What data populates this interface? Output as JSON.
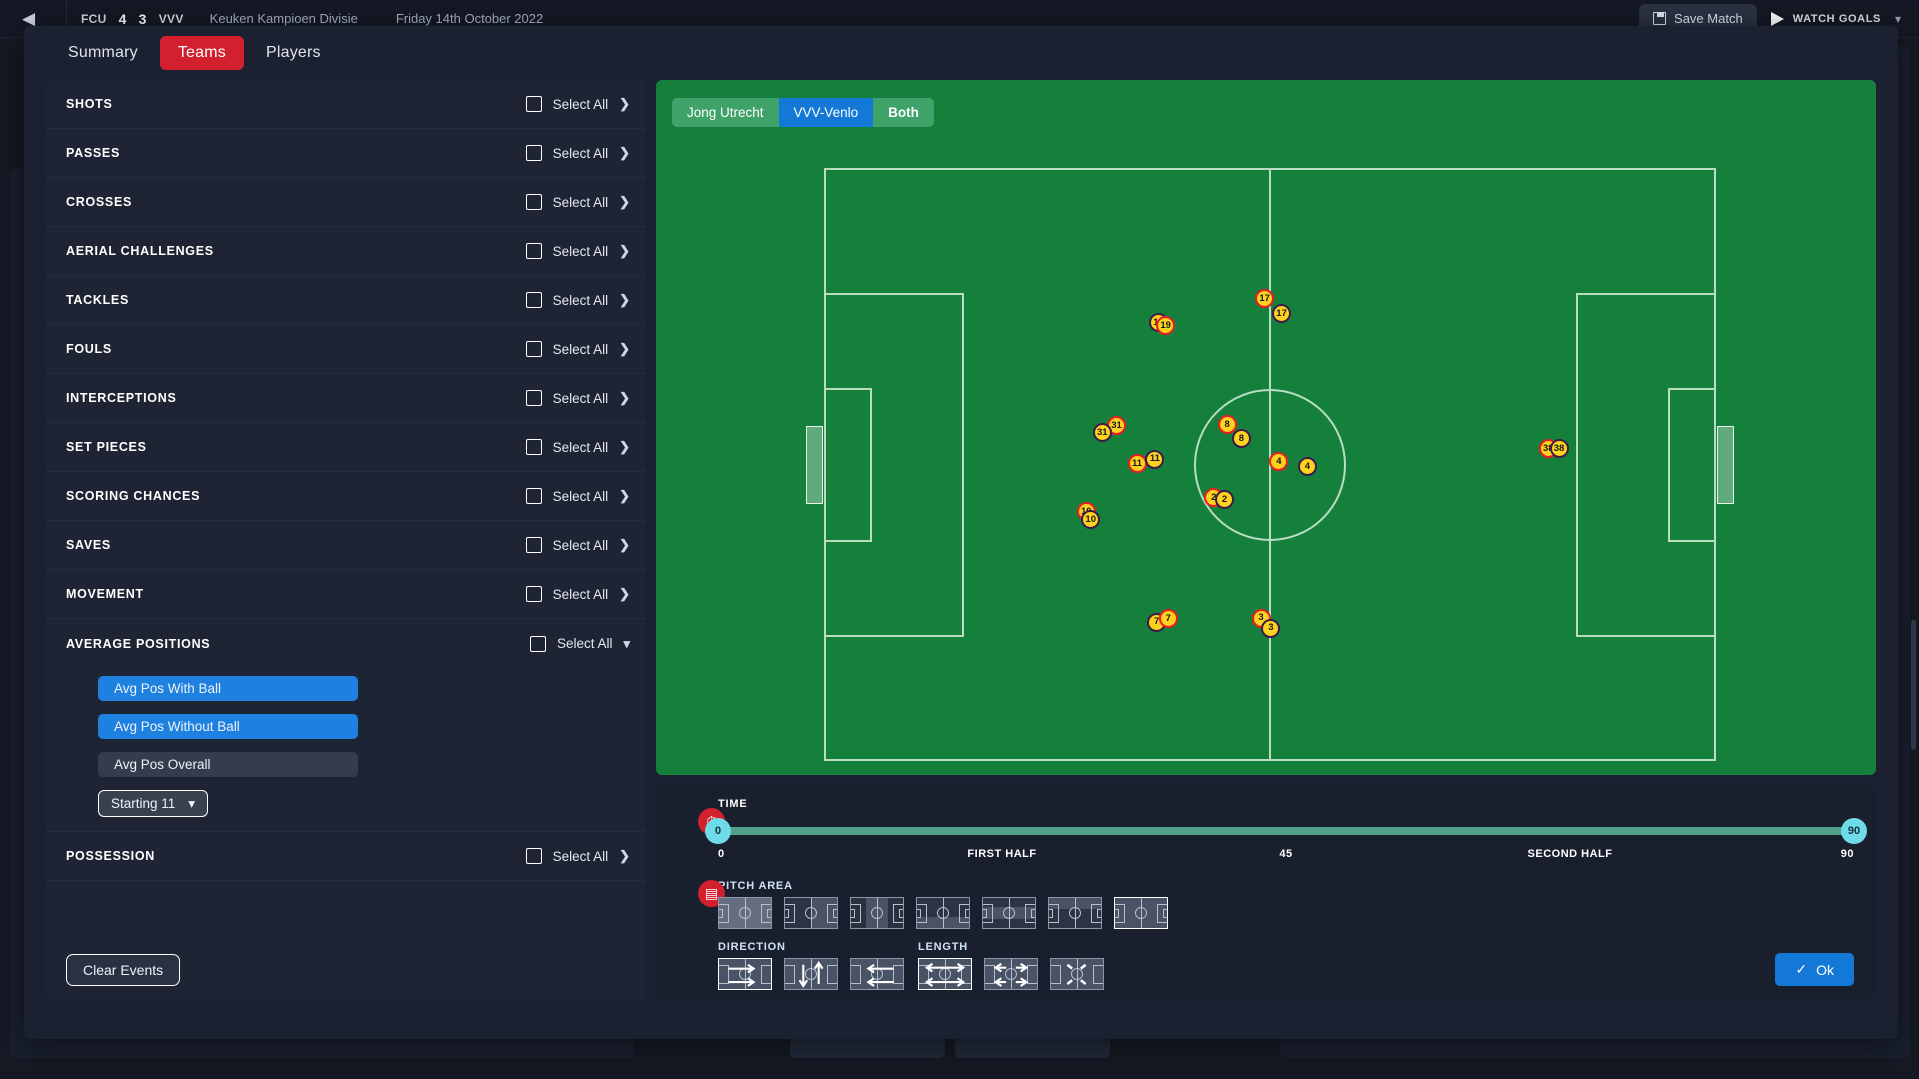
{
  "topbar": {
    "back_icon": "back-arrow-icon",
    "home_team": "FCU",
    "home_goals": "4",
    "away_goals": "3",
    "away_team": "VVV",
    "competition": "Keuken Kampioen Divisie",
    "date": "Friday 14th October 2022",
    "save_match_label": "Save Match",
    "save_icon": "floppy-disk-icon",
    "watch_goals_label": "WATCH GOALS",
    "play_icon": "play-icon",
    "chevron_icon": "chevron-down-icon"
  },
  "modal": {
    "tabs": [
      {
        "label": "Summary",
        "active": false
      },
      {
        "label": "Teams",
        "active": true
      },
      {
        "label": "Players",
        "active": false
      }
    ],
    "select_all_label": "Select All",
    "clear_events_label": "Clear Events",
    "ok_label": "Ok",
    "accent_red": "#d2202f",
    "accent_blue": "#1479d6"
  },
  "filters": [
    {
      "title": "SHOTS",
      "expanded": false
    },
    {
      "title": "PASSES",
      "expanded": false
    },
    {
      "title": "CROSSES",
      "expanded": false
    },
    {
      "title": "AERIAL CHALLENGES",
      "expanded": false
    },
    {
      "title": "TACKLES",
      "expanded": false
    },
    {
      "title": "FOULS",
      "expanded": false
    },
    {
      "title": "INTERCEPTIONS",
      "expanded": false
    },
    {
      "title": "SET PIECES",
      "expanded": false
    },
    {
      "title": "SCORING CHANCES",
      "expanded": false
    },
    {
      "title": "SAVES",
      "expanded": false
    },
    {
      "title": "MOVEMENT",
      "expanded": false
    },
    {
      "title": "AVERAGE POSITIONS",
      "expanded": true
    },
    {
      "title": "POSSESSION",
      "expanded": false
    }
  ],
  "average_positions": {
    "options": [
      {
        "label": "Avg Pos With Ball",
        "selected": true
      },
      {
        "label": "Avg Pos Without Ball",
        "selected": true
      },
      {
        "label": "Avg Pos Overall",
        "selected": false
      }
    ],
    "squad_selector": "Starting 11",
    "squad_selector_icon": "chevron-down-icon"
  },
  "pitch": {
    "team_toggle": [
      {
        "label": "Jong Utrecht",
        "selected": false
      },
      {
        "label": "VVV-Venlo",
        "selected": true
      },
      {
        "label": "Both",
        "selected": false
      }
    ],
    "markers": [
      {
        "num": "17",
        "type": "with",
        "x": 49.4,
        "y": 22.0
      },
      {
        "num": "17",
        "type": "without",
        "x": 51.3,
        "y": 24.6
      },
      {
        "num": "19",
        "type": "without",
        "x": 37.5,
        "y": 26.1
      },
      {
        "num": "19",
        "type": "with",
        "x": 38.3,
        "y": 26.6
      },
      {
        "num": "31",
        "type": "with",
        "x": 32.8,
        "y": 43.5
      },
      {
        "num": "31",
        "type": "without",
        "x": 31.2,
        "y": 44.6
      },
      {
        "num": "8",
        "type": "with",
        "x": 45.2,
        "y": 43.3
      },
      {
        "num": "8",
        "type": "without",
        "x": 46.8,
        "y": 45.6
      },
      {
        "num": "11",
        "type": "with",
        "x": 35.1,
        "y": 49.8
      },
      {
        "num": "11",
        "type": "without",
        "x": 37.1,
        "y": 49.1
      },
      {
        "num": "4",
        "type": "with",
        "x": 51.0,
        "y": 49.5
      },
      {
        "num": "4",
        "type": "without",
        "x": 54.2,
        "y": 50.4
      },
      {
        "num": "2",
        "type": "with",
        "x": 43.7,
        "y": 55.6
      },
      {
        "num": "2",
        "type": "without",
        "x": 44.9,
        "y": 55.9
      },
      {
        "num": "10",
        "type": "with",
        "x": 29.4,
        "y": 58.0
      },
      {
        "num": "10",
        "type": "without",
        "x": 29.9,
        "y": 59.3
      },
      {
        "num": "7",
        "type": "without",
        "x": 37.3,
        "y": 76.6
      },
      {
        "num": "7",
        "type": "with",
        "x": 38.6,
        "y": 76.0
      },
      {
        "num": "3",
        "type": "with",
        "x": 49.0,
        "y": 75.9
      },
      {
        "num": "3",
        "type": "without",
        "x": 50.1,
        "y": 77.6
      },
      {
        "num": "38",
        "type": "with",
        "x": 81.2,
        "y": 47.3
      },
      {
        "num": "38",
        "type": "without",
        "x": 82.4,
        "y": 47.3
      }
    ]
  },
  "timeline": {
    "icon": "stopwatch-icon",
    "label": "TIME",
    "start_value": "0",
    "end_value": "90",
    "axis": [
      {
        "text": "0",
        "pos": 0
      },
      {
        "text": "FIRST HALF",
        "pos": 25
      },
      {
        "text": "45",
        "pos": 50
      },
      {
        "text": "SECOND HALF",
        "pos": 75
      },
      {
        "text": "90",
        "pos": 100
      }
    ]
  },
  "pitch_area": {
    "icon": "pitch-area-icon",
    "label": "PITCH AREA",
    "options": [
      {
        "name": "defensive-third",
        "selected": false
      },
      {
        "name": "attacking-half",
        "selected": false
      },
      {
        "name": "middle-third",
        "selected": false
      },
      {
        "name": "bottom-channel",
        "selected": false
      },
      {
        "name": "central-channel",
        "selected": false
      },
      {
        "name": "top-channel",
        "selected": false
      },
      {
        "name": "whole-pitch",
        "selected": true
      }
    ]
  },
  "direction": {
    "label": "DIRECTION",
    "options": [
      {
        "name": "forward",
        "selected": true
      },
      {
        "name": "vertical",
        "selected": false
      },
      {
        "name": "backward",
        "selected": false
      }
    ]
  },
  "length": {
    "label": "LENGTH",
    "options": [
      {
        "name": "long",
        "selected": true
      },
      {
        "name": "medium",
        "selected": false
      },
      {
        "name": "short",
        "selected": false
      }
    ]
  }
}
